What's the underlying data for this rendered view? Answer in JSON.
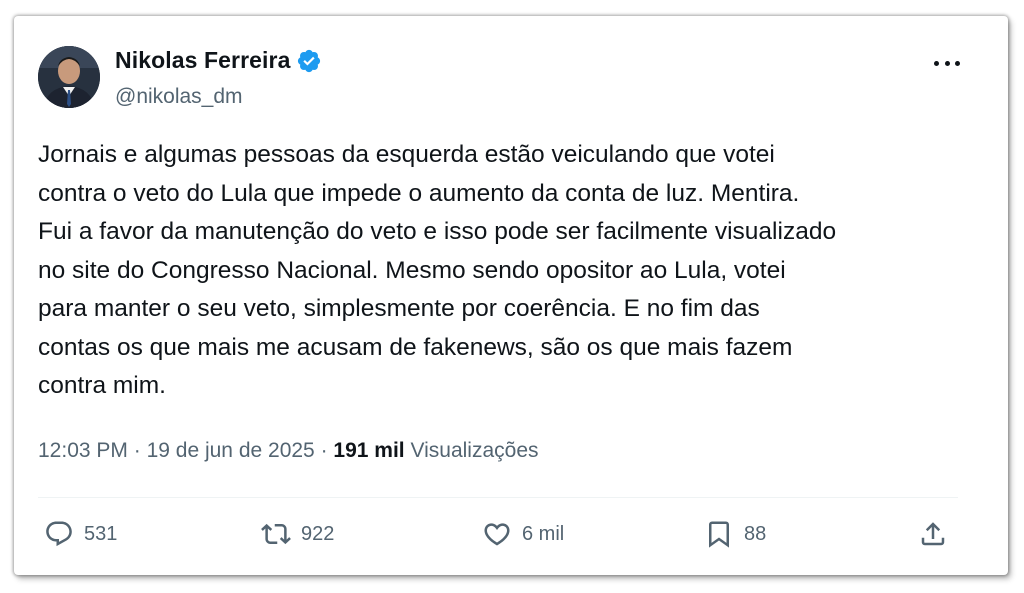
{
  "author": {
    "name": "Nikolas Ferreira",
    "handle": "@nikolas_dm",
    "verified_color": "#1d9bf0"
  },
  "tweet": {
    "text": "Jornais e algumas pessoas da esquerda estão veiculando que votei\ncontra o veto do Lula que impede o aumento da conta de luz. Mentira.\nFui a favor da manutenção do veto e isso pode ser facilmente visualizado\nno site do Congresso Nacional. Mesmo sendo opositor ao Lula, votei\npara manter o seu veto, simplesmente por coerência. E no fim das\ncontas os que mais me acusam de fakenews, são os que mais fazem\ncontra mim.",
    "time": "12:03 PM",
    "separator": "·",
    "date": "19 de jun de 2025",
    "views_count": "191 mil",
    "views_label": "Visualizações"
  },
  "actions": {
    "replies": "531",
    "retweets": "922",
    "likes": "6 mil",
    "bookmarks": "88"
  },
  "icons": {
    "more": "more-horizontal-icon",
    "reply": "reply-icon",
    "retweet": "retweet-icon",
    "like": "heart-icon",
    "bookmark": "bookmark-icon",
    "share": "share-icon",
    "verified": "verified-badge-icon"
  },
  "colors": {
    "text_primary": "#0f1419",
    "text_secondary": "#536471"
  }
}
